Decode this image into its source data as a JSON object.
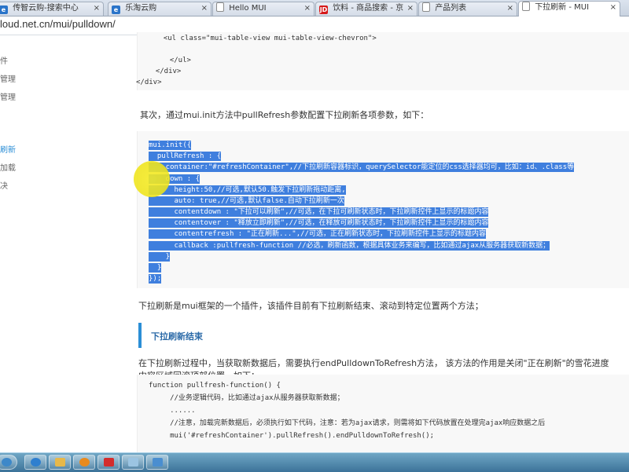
{
  "browser": {
    "tabs": [
      {
        "label": "传智云购-搜索中心",
        "icon": "ie-icon",
        "color": "#2a74c9"
      },
      {
        "label": "乐淘云购",
        "icon": "ie-icon",
        "color": "#2a74c9"
      },
      {
        "label": "Hello MUI",
        "icon": "document-icon",
        "color": "#8c8c8c"
      },
      {
        "label": "饮料 - 商品搜索 - 京",
        "icon": "jd-icon",
        "color": "#d61a1a"
      },
      {
        "label": "产品列表",
        "icon": "document-icon",
        "color": "#8c8c8c"
      },
      {
        "label": "下拉刷新 - MUI",
        "icon": "document-icon",
        "color": "#8c8c8c",
        "active": true
      }
    ],
    "close_glyph": "×",
    "url": "loud.net.cn/mui/pulldown/"
  },
  "sidebar": {
    "items": [
      {
        "label": "件"
      },
      {
        "label": "管理"
      },
      {
        "label": "管理"
      },
      {
        "label": "刷新",
        "active": true
      },
      {
        "label": "加载"
      },
      {
        "label": "决"
      }
    ]
  },
  "content": {
    "top_code": [
      "  <ul class=\"mui-table-view mui-table-view-chevron\">",
      "",
      "  </ul>",
      "  </div>",
      "</div>"
    ],
    "para1": "其次，通过mui.init方法中pullRefresh参数配置下拉刷新各项参数，如下：",
    "init_code": [
      "mui.init({",
      "  pullRefresh : {",
      "    container:\"#refreshContainer\",//下拉刷新容器标识，querySelector能定位的css选择器均可，比如：id、.class等",
      "    down : {",
      "      height:50,//可选,默认50.触发下拉刷新拖动距离,",
      "      auto: true,//可选,默认false.自动下拉刷新一次",
      "      contentdown : \"下拉可以刷新\",//可选，在下拉可刷新状态时，下拉刷新控件上显示的标题内容",
      "      contentover : \"释放立即刷新\",//可选，在释放可刷新状态时，下拉刷新控件上显示的标题内容",
      "      contentrefresh : \"正在刷新...\",//可选，正在刷新状态时，下拉刷新控件上显示的标题内容",
      "      callback :pullfresh-function //必选，刷新函数，根据具体业务来编写，比如通过ajax从服务器获取新数据；",
      "    }",
      "  }",
      "});"
    ],
    "para2": "下拉刷新是mui框架的一个插件，该插件目前有下拉刷新结束、滚动到特定位置两个方法；",
    "section_title": "下拉刷新结束",
    "para3_line1": "在下拉刷新过程中，当获取新数据后，需要执行endPulldownToRefresh方法， 该方法的作用是关闭\"正在刷新\"的雪花进度",
    "para3_line2": "内容区域回滚顶部位置，如下：。",
    "bottom_code": [
      "function pullfresh-function() {",
      "     //业务逻辑代码，比如通过ajax从服务器获取新数据；",
      "     ......",
      "     //注意，加载完新数据后，必须执行如下代码，注意：若为ajax请求，则需将如下代码放置在处理完ajax响应数据之后",
      "     mui('#refreshContainer').pullRefresh().endPulldownToRefresh();"
    ]
  },
  "taskbar": {
    "buttons": [
      {
        "icon": "start-orb-icon",
        "color": "#3d88c9"
      },
      {
        "icon": "ie-icon",
        "color": "#2f7fcf"
      },
      {
        "icon": "folder-icon",
        "color": "#e7b84a"
      },
      {
        "icon": "media-player-icon",
        "color": "#e98a1d"
      },
      {
        "icon": "video-recorder-icon",
        "color": "#d42c2c"
      },
      {
        "icon": "snipping-tool-icon",
        "color": "#9bc4e2"
      },
      {
        "icon": "screen-icon",
        "color": "#4a8ed0"
      }
    ]
  },
  "colors": {
    "selection": "#3f7fde",
    "accent": "#2b8ed6",
    "cursor_highlight": "#f2e61c"
  }
}
